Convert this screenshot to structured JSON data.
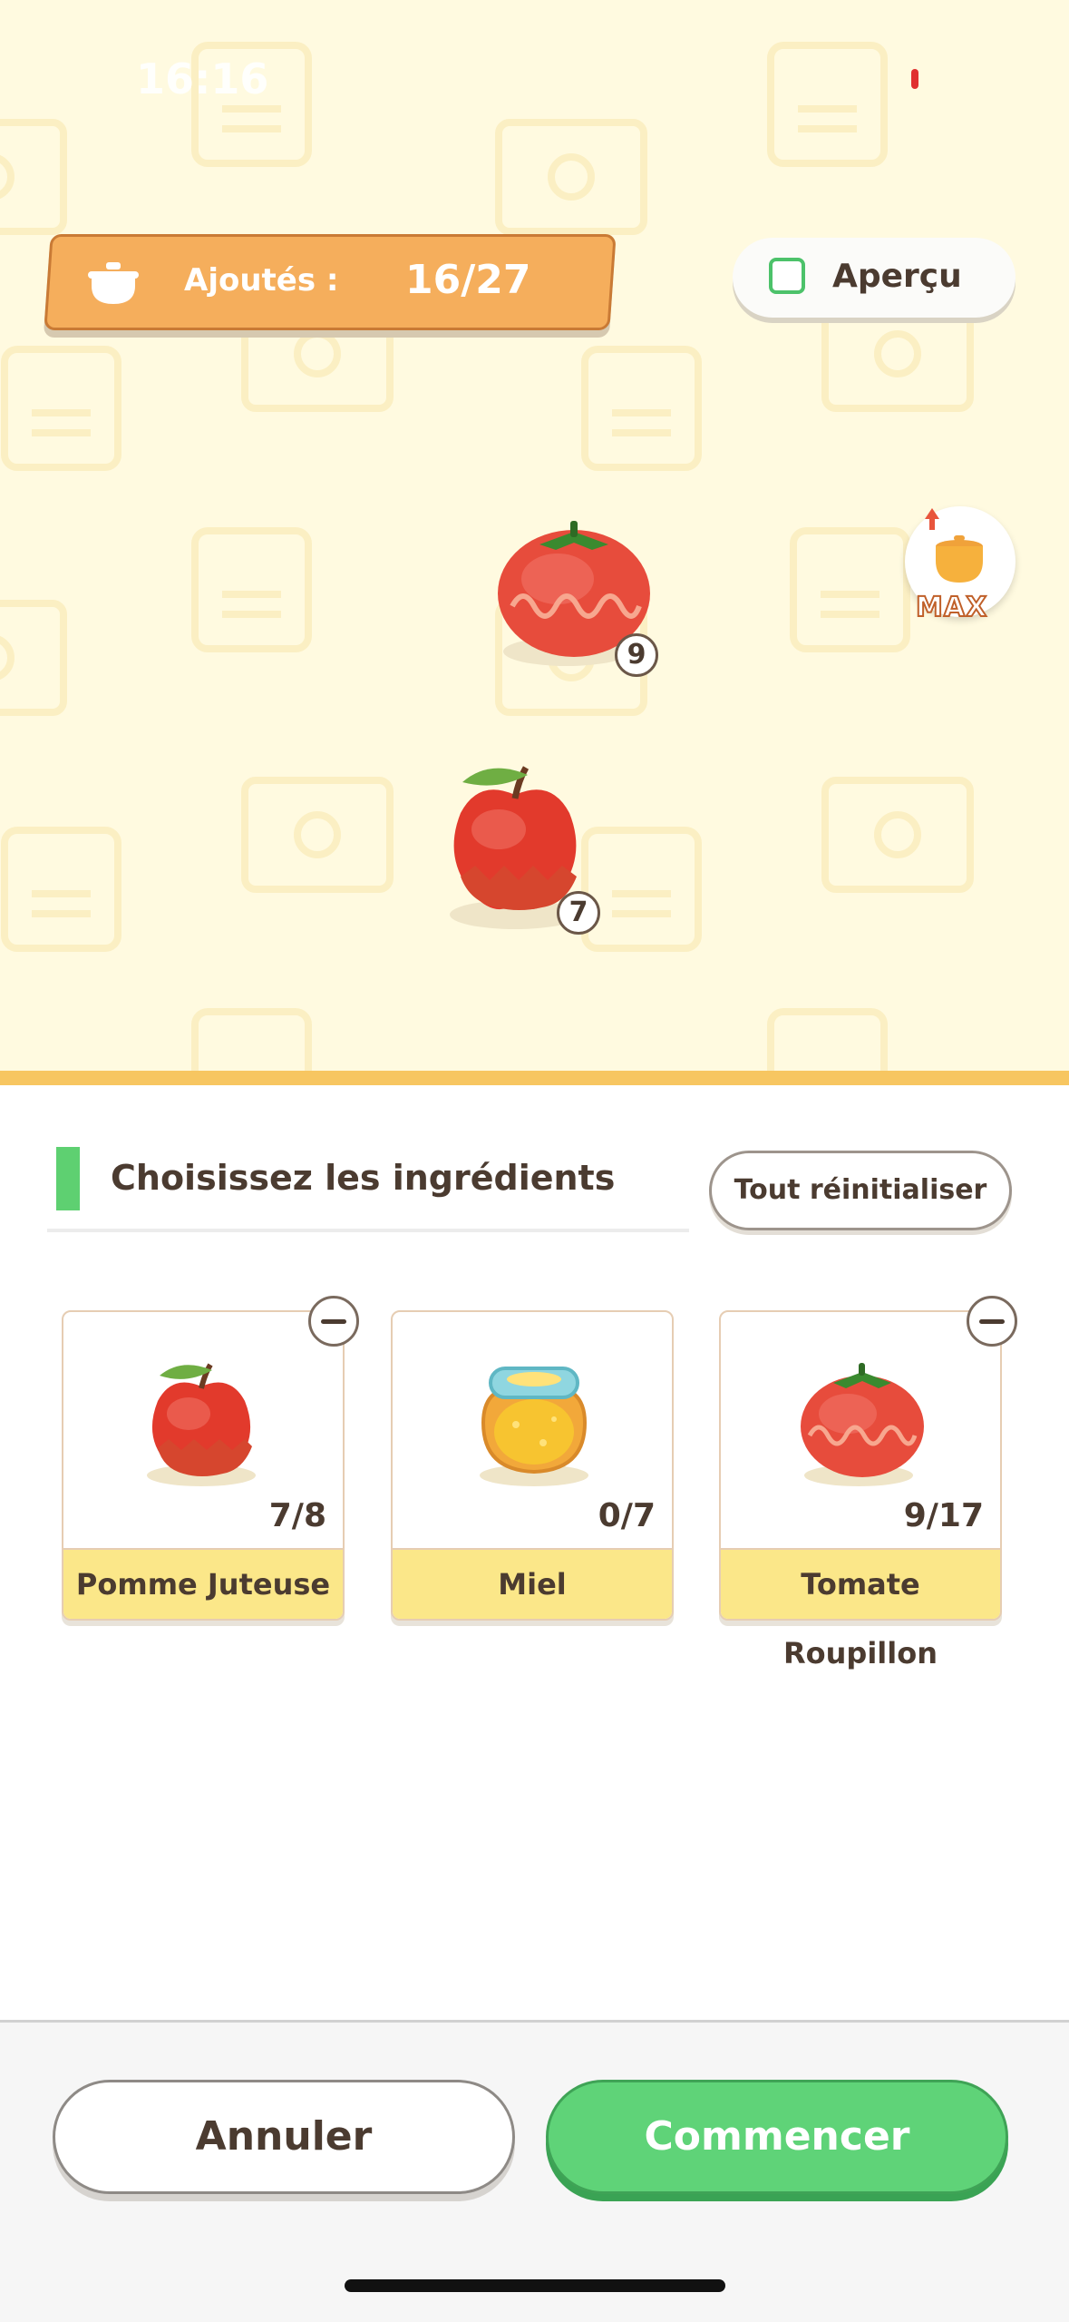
{
  "status_bar": {
    "time": "16:16"
  },
  "counter": {
    "label": "Ajoutés :",
    "value": "16/27",
    "icon": "cooking-pot-icon"
  },
  "preview": {
    "label": "Aperçu",
    "checked": false
  },
  "pot_level": {
    "label": "MAX",
    "icon": "cooking-pot-upgrade-icon"
  },
  "stage_items": [
    {
      "name": "Tomate Roupillon",
      "icon": "tomato-icon",
      "count": "9"
    },
    {
      "name": "Pomme Juteuse",
      "icon": "apple-icon",
      "count": "7"
    }
  ],
  "section": {
    "title": "Choisissez les ingrédients",
    "reset_label": "Tout réinitialiser"
  },
  "ingredients": [
    {
      "name": "Pomme Juteuse",
      "qty": "7/8",
      "icon": "apple-icon",
      "has_minus": true
    },
    {
      "name": "Miel",
      "qty": "0/7",
      "icon": "honey-jar-icon",
      "has_minus": false
    },
    {
      "name": "Tomate Roupillon",
      "qty": "9/17",
      "icon": "tomato-icon",
      "has_minus": true
    }
  ],
  "footer": {
    "cancel_label": "Annuler",
    "start_label": "Commencer"
  },
  "colors": {
    "accent_orange": "#f5ae5c",
    "accent_green": "#5fd378",
    "card_label_bg": "#fbe789"
  }
}
